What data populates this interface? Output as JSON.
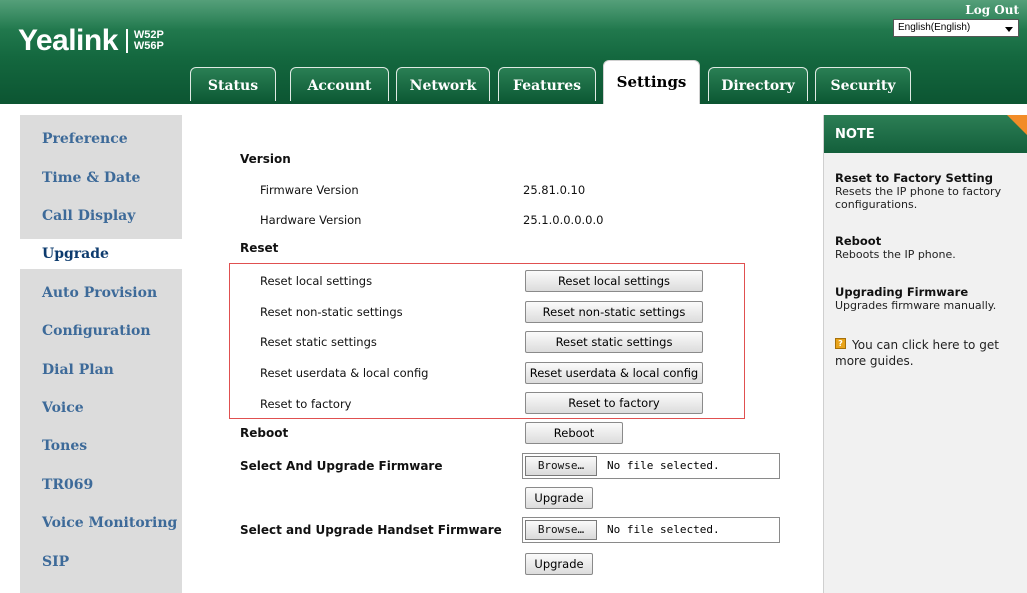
{
  "header": {
    "brand": "Yealink",
    "model_top": "W52P",
    "model_bottom": "W56P",
    "logout": "Log Out",
    "language": "English(English)"
  },
  "tabs": [
    "Status",
    "Account",
    "Network",
    "Features",
    "Settings",
    "Directory",
    "Security"
  ],
  "active_tab": "Settings",
  "sidebar": {
    "items": [
      "Preference",
      "Time & Date",
      "Call Display",
      "Upgrade",
      "Auto Provision",
      "Configuration",
      "Dial Plan",
      "Voice",
      "Tones",
      "TR069",
      "Voice Monitoring",
      "SIP"
    ],
    "active": "Upgrade"
  },
  "main": {
    "version_heading": "Version",
    "firmware_label": "Firmware Version",
    "firmware_value": "25.81.0.10",
    "hardware_label": "Hardware Version",
    "hardware_value": "25.1.0.0.0.0.0",
    "reset_heading": "Reset",
    "reset_rows": [
      {
        "label": "Reset local settings",
        "button": "Reset local settings"
      },
      {
        "label": "Reset non-static settings",
        "button": "Reset non-static settings"
      },
      {
        "label": "Reset static settings",
        "button": "Reset static settings"
      },
      {
        "label": "Reset userdata & local config",
        "button": "Reset userdata & local config"
      },
      {
        "label": "Reset to factory",
        "button": "Reset to factory"
      }
    ],
    "reboot_label": "Reboot",
    "reboot_button": "Reboot",
    "firmware_upgrade_label": "Select And Upgrade Firmware",
    "handset_upgrade_label": "Select and Upgrade Handset Firmware",
    "browse_button": "Browse…",
    "no_file": "No file selected.",
    "upgrade_button": "Upgrade"
  },
  "note": {
    "heading": "NOTE",
    "items": [
      {
        "title": "Reset to Factory Setting",
        "text": "Resets the IP phone to factory configurations."
      },
      {
        "title": "Reboot",
        "text": "Reboots the IP phone."
      },
      {
        "title": "Upgrading Firmware",
        "text": "Upgrades firmware manually."
      }
    ],
    "guide": "You can click here to get more guides.",
    "guide_icon": "?"
  },
  "colors": {
    "header_green": "#14683f",
    "sidebar_bg": "#dcdcdc",
    "sidebar_text": "#3d6a99",
    "highlight_border": "#e05050",
    "note_corner": "#f28c28"
  }
}
